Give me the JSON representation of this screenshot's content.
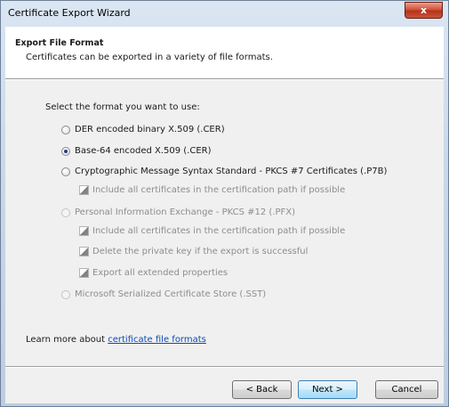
{
  "window": {
    "title": "Certificate Export Wizard",
    "close_glyph": "x"
  },
  "header": {
    "title": "Export File Format",
    "subtitle": "Certificates can be exported in a variety of file formats."
  },
  "prompt": "Select the format you want to use:",
  "options": {
    "der": {
      "label": "DER encoded binary X.509 (.CER)",
      "selected": false,
      "enabled": true
    },
    "base64": {
      "label": "Base-64 encoded X.509 (.CER)",
      "selected": true,
      "enabled": true
    },
    "pkcs7": {
      "label": "Cryptographic Message Syntax Standard - PKCS #7 Certificates (.P7B)",
      "selected": false,
      "enabled": true
    },
    "pkcs7_include": {
      "label": "Include all certificates in the certification path if possible",
      "enabled": false
    },
    "pfx": {
      "label": "Personal Information Exchange - PKCS #12 (.PFX)",
      "selected": false,
      "enabled": false
    },
    "pfx_include": {
      "label": "Include all certificates in the certification path if possible",
      "enabled": false
    },
    "pfx_delete": {
      "label": "Delete the private key if the export is successful",
      "enabled": false
    },
    "pfx_export_props": {
      "label": "Export all extended properties",
      "enabled": false
    },
    "sst": {
      "label": "Microsoft Serialized Certificate Store (.SST)",
      "selected": false,
      "enabled": false
    }
  },
  "learn_more": {
    "prefix": "Learn more about ",
    "link": "certificate file formats"
  },
  "buttons": {
    "back": "< Back",
    "next": "Next >",
    "cancel": "Cancel"
  }
}
